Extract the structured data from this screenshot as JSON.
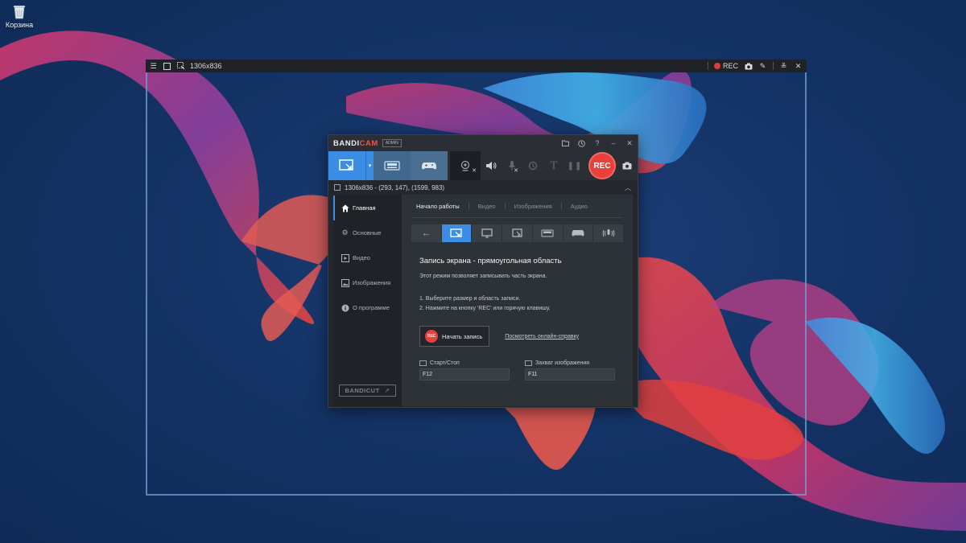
{
  "desktop": {
    "recycle_bin_label": "Корзина"
  },
  "capture_bar": {
    "size": "1306x836",
    "rec_label": "REC"
  },
  "window": {
    "logo_part1": "BANDI",
    "logo_part2": "CAM",
    "badge": "ADMIN",
    "rec_button": "REC",
    "info_text": "1306x836 - (293, 147), (1599, 983)",
    "accent_color": "#3b8de6",
    "rec_color": "#e8403a"
  },
  "sidebar": {
    "items": [
      {
        "label": "Главная",
        "icon": "home-icon"
      },
      {
        "label": "Основные",
        "icon": "gear-icon"
      },
      {
        "label": "Видео",
        "icon": "video-icon"
      },
      {
        "label": "Изображения",
        "icon": "image-icon"
      },
      {
        "label": "О программе",
        "icon": "info-icon"
      }
    ],
    "bandicut": "BANDICUT"
  },
  "tabs": [
    "Начало работы",
    "Видео",
    "Изображения",
    "Аудио"
  ],
  "content": {
    "title": "Запись экрана - прямоугольная область",
    "description": "Этот режим позволяет записывать часть экрана.",
    "step1": "1. Выберите размер и область записи.",
    "step2": "2. Нажмите на кнопку 'REC' или горячую клавишу.",
    "start_button": "Начать запись",
    "start_button_badge": "REC",
    "help_link": "Посмотреть онлайн-справку",
    "hotkey1_label": "Старт/Стоп",
    "hotkey1_value": "F12",
    "hotkey2_label": "Захват изображения",
    "hotkey2_value": "F11"
  }
}
